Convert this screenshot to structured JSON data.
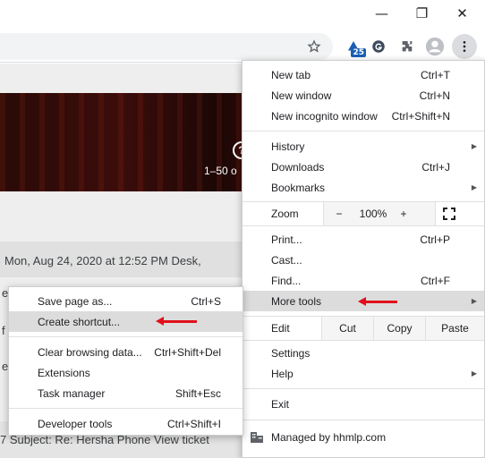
{
  "window_controls": {
    "minimize": "—",
    "restore": "❐",
    "close": "✕"
  },
  "toolbar": {
    "star_icon": "star-icon",
    "ext_badge_count": "25",
    "ext2_icon": "grammarly-icon",
    "puzzle_icon": "puzzle-icon",
    "profile_icon": "profile-icon",
    "menu_icon": "kebab-menu-icon"
  },
  "page": {
    "results_text": "1–50 o",
    "row1_text": "Mon, Aug 24, 2020 at 12:52 PM Desk,",
    "row2_text": "et",
    "row3_text": "f",
    "row4_text": "e",
    "bottom_text": "7 Subject: Re: Hersha Phone View ticket"
  },
  "main_menu": {
    "new_tab": {
      "label": "New tab",
      "shortcut": "Ctrl+T"
    },
    "new_window": {
      "label": "New window",
      "shortcut": "Ctrl+N"
    },
    "new_incognito": {
      "label": "New incognito window",
      "shortcut": "Ctrl+Shift+N"
    },
    "history": {
      "label": "History"
    },
    "downloads": {
      "label": "Downloads",
      "shortcut": "Ctrl+J"
    },
    "bookmarks": {
      "label": "Bookmarks"
    },
    "zoom": {
      "label": "Zoom",
      "minus": "−",
      "value": "100%",
      "plus": "+",
      "fullscreen": "⛶"
    },
    "print": {
      "label": "Print...",
      "shortcut": "Ctrl+P"
    },
    "cast": {
      "label": "Cast..."
    },
    "find": {
      "label": "Find...",
      "shortcut": "Ctrl+F"
    },
    "more_tools": {
      "label": "More tools"
    },
    "edit": {
      "label": "Edit",
      "cut": "Cut",
      "copy": "Copy",
      "paste": "Paste"
    },
    "settings": {
      "label": "Settings"
    },
    "help": {
      "label": "Help"
    },
    "exit": {
      "label": "Exit"
    },
    "managed": {
      "label": "Managed by hhmlp.com"
    }
  },
  "sub_menu": {
    "save_page": {
      "label": "Save page as...",
      "shortcut": "Ctrl+S"
    },
    "create_shortcut": {
      "label": "Create shortcut..."
    },
    "clear_browsing": {
      "label": "Clear browsing data...",
      "shortcut": "Ctrl+Shift+Del"
    },
    "extensions": {
      "label": "Extensions"
    },
    "task_manager": {
      "label": "Task manager",
      "shortcut": "Shift+Esc"
    },
    "developer_tools": {
      "label": "Developer tools",
      "shortcut": "Ctrl+Shift+I"
    }
  },
  "colors": {
    "highlight": "#dcdcdc",
    "arrow": "#e0101a",
    "badge": "#1a5fb4"
  }
}
